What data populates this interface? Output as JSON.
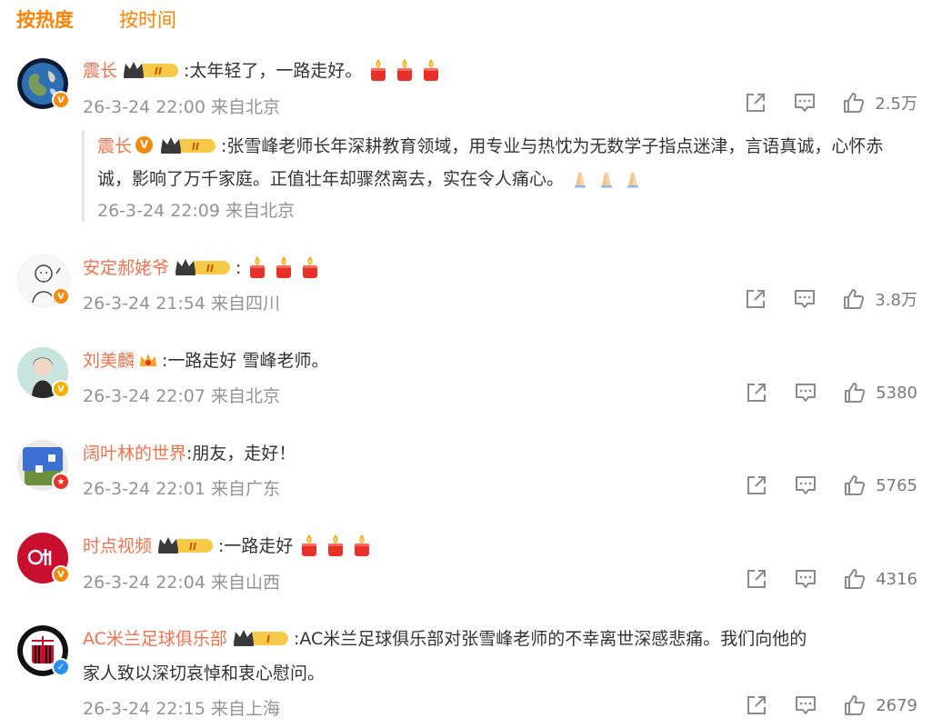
{
  "tabs": {
    "hot": "按热度",
    "time": "按时间"
  },
  "colors": {
    "accent": "#ff8200",
    "username": "#eb7350",
    "meta": "#939393"
  },
  "comments": [
    {
      "user": "震长",
      "vip": "II",
      "text": ":太年轻了，一路走好。",
      "emoji_count": 3,
      "meta": "26-3-24 22:00 来自北京",
      "likes": "2.5万",
      "reply": {
        "user": "震长",
        "vip": "II",
        "text": ":张雪峰老师长年深耕教育领域，用专业与热忱为无数学子指点迷津，言语真诚，心怀赤诚，影响了万千家庭。正值壮年却骤然离去，实在令人痛心。",
        "meta": "26-3-24 22:09 来自北京"
      }
    },
    {
      "user": "安定郝姥爷",
      "vip": "II",
      "text": ":",
      "emoji_count": 3,
      "meta": "26-3-24 21:54 来自四川",
      "likes": "3.8万"
    },
    {
      "user": "刘美麟",
      "text": ":一路走好 雪峰老师。",
      "meta": "26-3-24 22:07 来自北京",
      "likes": "5380"
    },
    {
      "user": "阔叶林的世界",
      "text": ":朋友，走好！",
      "meta": "26-3-24 22:01 来自广东",
      "likes": "5765"
    },
    {
      "user": "时点视频",
      "vip": "II",
      "text": ":一路走好",
      "emoji_count": 3,
      "meta": "26-3-24 22:04 来自山西",
      "likes": "4316"
    },
    {
      "user": "AC米兰足球俱乐部",
      "vip": "I",
      "text": ":AC米兰足球俱乐部对张雪峰老师的不幸离世深感悲痛。我们向他的",
      "text2": "家人致以深切哀悼和衷心慰问。",
      "meta": "26-3-24 22:15 来自上海",
      "likes": "2679"
    }
  ],
  "icons": {
    "share": "share-icon",
    "comment": "comment-icon",
    "like": "thumb-up-icon",
    "emoji": "candle-emoji",
    "prayer": "folded-hands-emoji"
  }
}
